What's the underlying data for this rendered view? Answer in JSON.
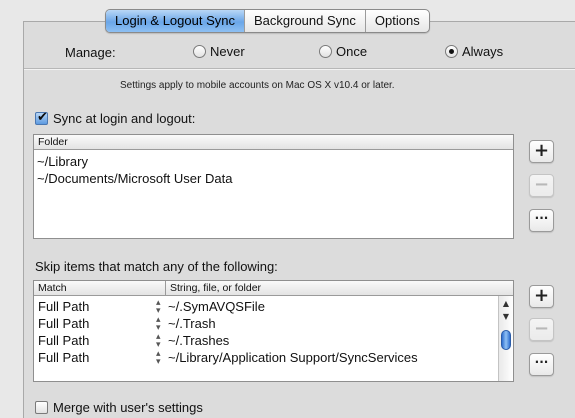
{
  "tabs": [
    {
      "label": "Login & Logout Sync",
      "selected": true
    },
    {
      "label": "Background Sync",
      "selected": false
    },
    {
      "label": "Options",
      "selected": false
    }
  ],
  "manage": {
    "label": "Manage:",
    "options": [
      {
        "label": "Never",
        "selected": false
      },
      {
        "label": "Once",
        "selected": false
      },
      {
        "label": "Always",
        "selected": true
      }
    ]
  },
  "note": "Settings apply to mobile accounts on Mac OS X v10.4 or later.",
  "sync_login": {
    "label": "Sync at login and logout:",
    "checked": true,
    "column_header": "Folder",
    "folders": [
      "~/Library",
      "~/Documents/Microsoft User Data"
    ]
  },
  "buttons": {
    "add": "+",
    "remove": "−",
    "more": "···"
  },
  "skip": {
    "label": "Skip items that match any of the following:",
    "headers": {
      "match": "Match",
      "value": "String, file, or folder"
    },
    "rows": [
      {
        "match": "Full Path",
        "value": "~/.SymAVQSFile"
      },
      {
        "match": "Full Path",
        "value": "~/.Trash"
      },
      {
        "match": "Full Path",
        "value": "~/.Trashes"
      },
      {
        "match": "Full Path",
        "value": "~/Library/Application Support/SyncServices"
      }
    ]
  },
  "merge": {
    "label": "Merge with user's settings",
    "checked": false
  },
  "colors": {
    "selected_tab": "#6aa6e8",
    "scroll_thumb": "#2f6fd0"
  },
  "icons": {
    "stepper": "↕",
    "scroll_up": "▲",
    "scroll_down": "▼"
  }
}
